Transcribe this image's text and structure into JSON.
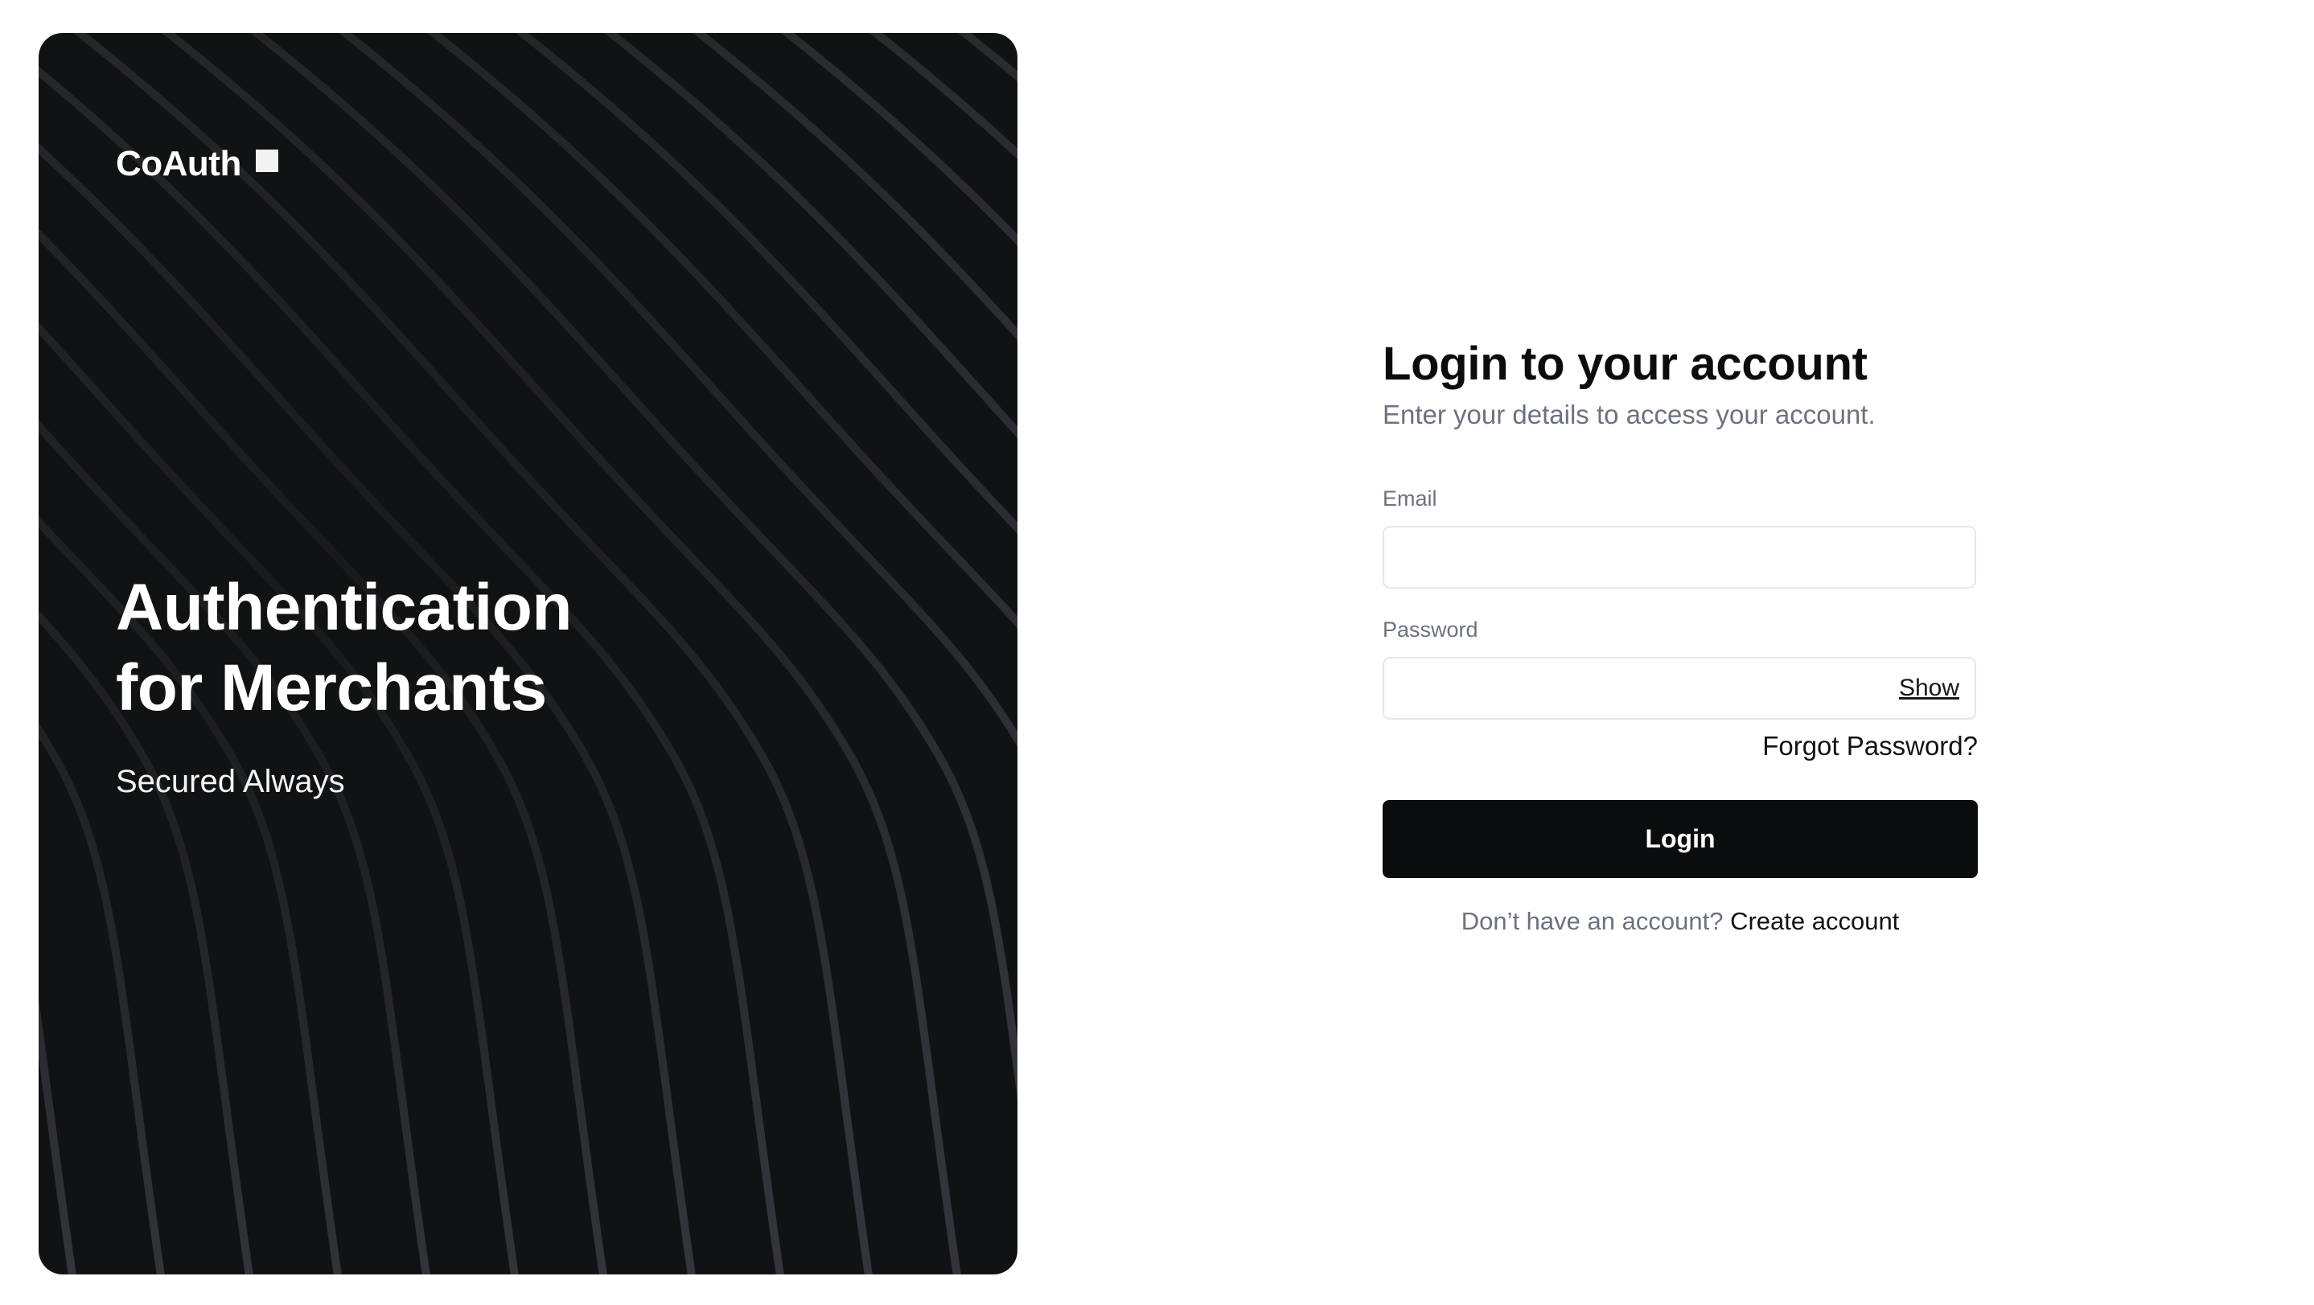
{
  "brand": {
    "logo_text": "CoAuth",
    "logo_mark": "square-icon",
    "headline_line1": "Authentication",
    "headline_line2": "for Merchants",
    "tagline": "Secured Always",
    "panel_color": "#111214"
  },
  "login": {
    "title": "Login to your account",
    "subtitle": "Enter your details to access your account.",
    "email_label": "Email",
    "email_value": "",
    "password_label": "Password",
    "password_value": "",
    "show_label": "Show",
    "forgot_label": "Forgot Password?",
    "submit_label": "Login",
    "no_account_text": "Don’t have an account?",
    "create_account_label": "Create account",
    "button_color": "#0b0c0e"
  }
}
